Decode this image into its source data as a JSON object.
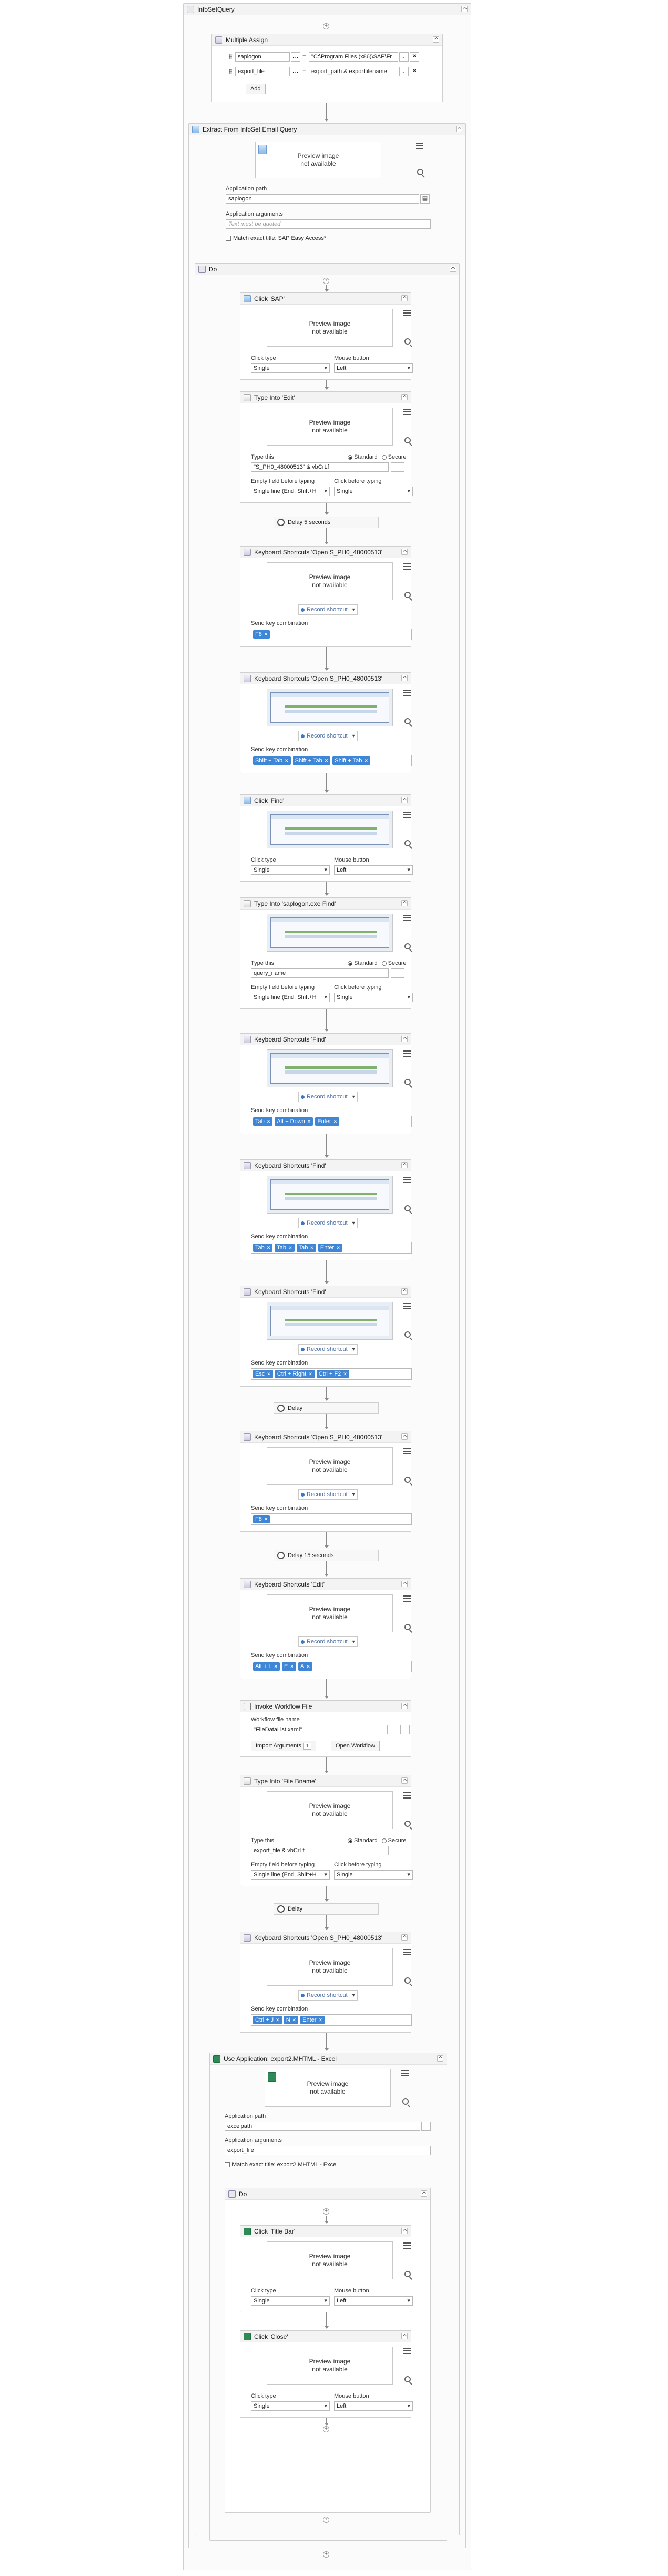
{
  "root": {
    "title": "InfoSetQuery"
  },
  "multiple_assign": {
    "title": "Multiple Assign",
    "rows": [
      {
        "var": "saplogon",
        "op": "=",
        "value": "\"C:\\Program Files (x86)\\SAP\\Fr"
      },
      {
        "var": "export_file",
        "op": "=",
        "value": "export_path & exportfilename"
      }
    ],
    "add_label": "Add"
  },
  "extract": {
    "title": "Extract From InfoSet Email Query",
    "preview": "Preview image\nnot available",
    "app_path_label": "Application path",
    "app_path_value": "saplogon",
    "app_args_label": "Application arguments",
    "app_args_placeholder": "Text must be quoted",
    "match_title_label": "Match exact title: SAP Easy Access*"
  },
  "do_seq": {
    "title": "Do"
  },
  "activities": {
    "click_sap": {
      "title": "Click 'SAP'",
      "preview": "Preview image\nnot available",
      "click_type_label": "Click type",
      "mouse_button_label": "Mouse button",
      "click_type": "Single",
      "mouse_button": "Left"
    },
    "type_edit": {
      "title": "Type Into 'Edit'",
      "preview": "Preview image\nnot available",
      "type_this_label": "Type this",
      "standard": "Standard",
      "secure": "Secure",
      "value": "\"S_PH0_48000513\" & vbCrLf",
      "empty_label": "Empty field before typing",
      "click_before_label": "Click before typing",
      "empty_value": "Single line (End, Shift+H",
      "click_value": "Single"
    },
    "delay1": {
      "title": "Delay 5 seconds"
    },
    "ks_open1": {
      "title": "Keyboard Shortcuts 'Open S_PH0_48000513'",
      "preview": "Preview image\nnot available",
      "record": "Record shortcut",
      "send_label": "Send key combination",
      "keys": [
        "F8"
      ]
    },
    "ks_open2": {
      "title": "Keyboard Shortcuts 'Open S_PH0_48000513'",
      "record": "Record shortcut",
      "send_label": "Send key combination",
      "keys": [
        "Shift + Tab",
        "Shift + Tab",
        "Shift + Tab"
      ]
    },
    "click_find": {
      "title": "Click 'Find'",
      "click_type_label": "Click type",
      "mouse_button_label": "Mouse button",
      "click_type": "Single",
      "mouse_button": "Left"
    },
    "type_find": {
      "title": "Type Into 'saplogon.exe Find'",
      "type_this_label": "Type this",
      "standard": "Standard",
      "secure": "Secure",
      "value": "query_name",
      "empty_label": "Empty field before typing",
      "click_before_label": "Click before typing",
      "empty_value": "Single line (End, Shift+H",
      "click_value": "Single"
    },
    "ks_find1": {
      "title": "Keyboard Shortcuts 'Find'",
      "record": "Record shortcut",
      "send_label": "Send key combination",
      "keys": [
        "Tab",
        "Alt + Down",
        "Enter"
      ]
    },
    "ks_find2": {
      "title": "Keyboard Shortcuts 'Find'",
      "record": "Record shortcut",
      "send_label": "Send key combination",
      "keys": [
        "Tab",
        "Tab",
        "Tab",
        "Enter"
      ]
    },
    "ks_find3": {
      "title": "Keyboard Shortcuts 'Find'",
      "record": "Record shortcut",
      "send_label": "Send key combination",
      "keys": [
        "Esc",
        "Ctrl + Right",
        "Ctrl + F2"
      ]
    },
    "delay2": {
      "title": "Delay"
    },
    "ks_open3": {
      "title": "Keyboard Shortcuts 'Open S_PH0_48000513'",
      "preview": "Preview image\nnot available",
      "record": "Record shortcut",
      "send_label": "Send key combination",
      "keys": [
        "F8"
      ]
    },
    "delay3": {
      "title": "Delay 15 seconds"
    },
    "ks_edit": {
      "title": "Keyboard Shortcuts 'Edit'",
      "preview": "Preview image\nnot available",
      "record": "Record shortcut",
      "send_label": "Send key combination",
      "keys": [
        "Alt + L",
        "E",
        "A"
      ]
    },
    "invoke": {
      "title": "Invoke Workflow File",
      "file_label": "Workflow file name",
      "file_value": "\"FileDataList.xaml\"",
      "import_label": "Import Arguments",
      "import_count": "1",
      "open_label": "Open Workflow"
    },
    "type_filename": {
      "title": "Type Into 'File Bname'",
      "preview": "Preview image\nnot available",
      "type_this_label": "Type this",
      "standard": "Standard",
      "secure": "Secure",
      "value": "export_file & vbCrLf",
      "empty_label": "Empty field before typing",
      "click_before_label": "Click before typing",
      "empty_value": "Single line (End, Shift+H",
      "click_value": "Single"
    },
    "delay4": {
      "title": "Delay"
    },
    "ks_open4": {
      "title": "Keyboard Shortcuts 'Open S_PH0_48000513'",
      "preview": "Preview image\nnot available",
      "record": "Record shortcut",
      "send_label": "Send key combination",
      "keys": [
        "Ctrl + J",
        "N",
        "Enter"
      ]
    }
  },
  "use_app": {
    "title": "Use Application: export2.MHTML - Excel",
    "preview": "Preview image\nnot available",
    "app_path_label": "Application path",
    "app_path_value": "excelpath",
    "app_args_label": "Application arguments",
    "app_args_value": "export_file",
    "match_title_label": "Match exact title: export2.MHTML - Excel",
    "do_title": "Do",
    "click_titlebar": {
      "title": "Click 'Title Bar'",
      "preview": "Preview image\nnot available",
      "click_type_label": "Click type",
      "mouse_button_label": "Mouse button",
      "click_type": "Single",
      "mouse_button": "Left"
    },
    "click_close": {
      "title": "Click 'Close'",
      "preview": "Preview image\nnot available",
      "click_type_label": "Click type",
      "mouse_button_label": "Mouse button",
      "click_type": "Single",
      "mouse_button": "Left"
    }
  },
  "colors": {
    "key_chip": "#3f86d6",
    "accent": "#3a78c3"
  }
}
